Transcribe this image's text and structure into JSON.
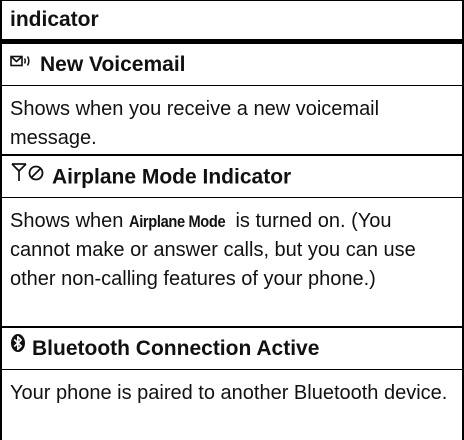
{
  "header": {
    "title": "indicator"
  },
  "rows": [
    {
      "icon": "voicemail-icon",
      "title": "New Voicemail",
      "description": "Shows when you receive a new voicemail message."
    },
    {
      "icon": "airplane-mode-icon",
      "title": "Airplane Mode Indicator",
      "description_prefix": "Shows when ",
      "description_keyword": "Airplane Mode",
      "description_suffix": " is turned on. (You cannot make or answer calls, but you can use other non-calling features of your phone.)"
    },
    {
      "icon": "bluetooth-icon",
      "title": "Bluetooth Connection Active",
      "description": "Your phone is paired to another Bluetooth device."
    }
  ]
}
